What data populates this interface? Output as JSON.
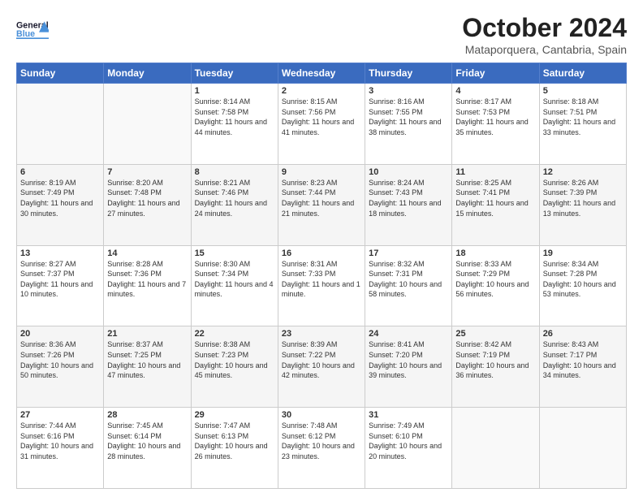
{
  "header": {
    "logo_general": "General",
    "logo_blue": "Blue",
    "month_title": "October 2024",
    "location": "Mataporquera, Cantabria, Spain"
  },
  "days_of_week": [
    "Sunday",
    "Monday",
    "Tuesday",
    "Wednesday",
    "Thursday",
    "Friday",
    "Saturday"
  ],
  "weeks": [
    [
      {
        "day": "",
        "sunrise": "",
        "sunset": "",
        "daylight": ""
      },
      {
        "day": "",
        "sunrise": "",
        "sunset": "",
        "daylight": ""
      },
      {
        "day": "1",
        "sunrise": "Sunrise: 8:14 AM",
        "sunset": "Sunset: 7:58 PM",
        "daylight": "Daylight: 11 hours and 44 minutes."
      },
      {
        "day": "2",
        "sunrise": "Sunrise: 8:15 AM",
        "sunset": "Sunset: 7:56 PM",
        "daylight": "Daylight: 11 hours and 41 minutes."
      },
      {
        "day": "3",
        "sunrise": "Sunrise: 8:16 AM",
        "sunset": "Sunset: 7:55 PM",
        "daylight": "Daylight: 11 hours and 38 minutes."
      },
      {
        "day": "4",
        "sunrise": "Sunrise: 8:17 AM",
        "sunset": "Sunset: 7:53 PM",
        "daylight": "Daylight: 11 hours and 35 minutes."
      },
      {
        "day": "5",
        "sunrise": "Sunrise: 8:18 AM",
        "sunset": "Sunset: 7:51 PM",
        "daylight": "Daylight: 11 hours and 33 minutes."
      }
    ],
    [
      {
        "day": "6",
        "sunrise": "Sunrise: 8:19 AM",
        "sunset": "Sunset: 7:49 PM",
        "daylight": "Daylight: 11 hours and 30 minutes."
      },
      {
        "day": "7",
        "sunrise": "Sunrise: 8:20 AM",
        "sunset": "Sunset: 7:48 PM",
        "daylight": "Daylight: 11 hours and 27 minutes."
      },
      {
        "day": "8",
        "sunrise": "Sunrise: 8:21 AM",
        "sunset": "Sunset: 7:46 PM",
        "daylight": "Daylight: 11 hours and 24 minutes."
      },
      {
        "day": "9",
        "sunrise": "Sunrise: 8:23 AM",
        "sunset": "Sunset: 7:44 PM",
        "daylight": "Daylight: 11 hours and 21 minutes."
      },
      {
        "day": "10",
        "sunrise": "Sunrise: 8:24 AM",
        "sunset": "Sunset: 7:43 PM",
        "daylight": "Daylight: 11 hours and 18 minutes."
      },
      {
        "day": "11",
        "sunrise": "Sunrise: 8:25 AM",
        "sunset": "Sunset: 7:41 PM",
        "daylight": "Daylight: 11 hours and 15 minutes."
      },
      {
        "day": "12",
        "sunrise": "Sunrise: 8:26 AM",
        "sunset": "Sunset: 7:39 PM",
        "daylight": "Daylight: 11 hours and 13 minutes."
      }
    ],
    [
      {
        "day": "13",
        "sunrise": "Sunrise: 8:27 AM",
        "sunset": "Sunset: 7:37 PM",
        "daylight": "Daylight: 11 hours and 10 minutes."
      },
      {
        "day": "14",
        "sunrise": "Sunrise: 8:28 AM",
        "sunset": "Sunset: 7:36 PM",
        "daylight": "Daylight: 11 hours and 7 minutes."
      },
      {
        "day": "15",
        "sunrise": "Sunrise: 8:30 AM",
        "sunset": "Sunset: 7:34 PM",
        "daylight": "Daylight: 11 hours and 4 minutes."
      },
      {
        "day": "16",
        "sunrise": "Sunrise: 8:31 AM",
        "sunset": "Sunset: 7:33 PM",
        "daylight": "Daylight: 11 hours and 1 minute."
      },
      {
        "day": "17",
        "sunrise": "Sunrise: 8:32 AM",
        "sunset": "Sunset: 7:31 PM",
        "daylight": "Daylight: 10 hours and 58 minutes."
      },
      {
        "day": "18",
        "sunrise": "Sunrise: 8:33 AM",
        "sunset": "Sunset: 7:29 PM",
        "daylight": "Daylight: 10 hours and 56 minutes."
      },
      {
        "day": "19",
        "sunrise": "Sunrise: 8:34 AM",
        "sunset": "Sunset: 7:28 PM",
        "daylight": "Daylight: 10 hours and 53 minutes."
      }
    ],
    [
      {
        "day": "20",
        "sunrise": "Sunrise: 8:36 AM",
        "sunset": "Sunset: 7:26 PM",
        "daylight": "Daylight: 10 hours and 50 minutes."
      },
      {
        "day": "21",
        "sunrise": "Sunrise: 8:37 AM",
        "sunset": "Sunset: 7:25 PM",
        "daylight": "Daylight: 10 hours and 47 minutes."
      },
      {
        "day": "22",
        "sunrise": "Sunrise: 8:38 AM",
        "sunset": "Sunset: 7:23 PM",
        "daylight": "Daylight: 10 hours and 45 minutes."
      },
      {
        "day": "23",
        "sunrise": "Sunrise: 8:39 AM",
        "sunset": "Sunset: 7:22 PM",
        "daylight": "Daylight: 10 hours and 42 minutes."
      },
      {
        "day": "24",
        "sunrise": "Sunrise: 8:41 AM",
        "sunset": "Sunset: 7:20 PM",
        "daylight": "Daylight: 10 hours and 39 minutes."
      },
      {
        "day": "25",
        "sunrise": "Sunrise: 8:42 AM",
        "sunset": "Sunset: 7:19 PM",
        "daylight": "Daylight: 10 hours and 36 minutes."
      },
      {
        "day": "26",
        "sunrise": "Sunrise: 8:43 AM",
        "sunset": "Sunset: 7:17 PM",
        "daylight": "Daylight: 10 hours and 34 minutes."
      }
    ],
    [
      {
        "day": "27",
        "sunrise": "Sunrise: 7:44 AM",
        "sunset": "Sunset: 6:16 PM",
        "daylight": "Daylight: 10 hours and 31 minutes."
      },
      {
        "day": "28",
        "sunrise": "Sunrise: 7:45 AM",
        "sunset": "Sunset: 6:14 PM",
        "daylight": "Daylight: 10 hours and 28 minutes."
      },
      {
        "day": "29",
        "sunrise": "Sunrise: 7:47 AM",
        "sunset": "Sunset: 6:13 PM",
        "daylight": "Daylight: 10 hours and 26 minutes."
      },
      {
        "day": "30",
        "sunrise": "Sunrise: 7:48 AM",
        "sunset": "Sunset: 6:12 PM",
        "daylight": "Daylight: 10 hours and 23 minutes."
      },
      {
        "day": "31",
        "sunrise": "Sunrise: 7:49 AM",
        "sunset": "Sunset: 6:10 PM",
        "daylight": "Daylight: 10 hours and 20 minutes."
      },
      {
        "day": "",
        "sunrise": "",
        "sunset": "",
        "daylight": ""
      },
      {
        "day": "",
        "sunrise": "",
        "sunset": "",
        "daylight": ""
      }
    ]
  ]
}
